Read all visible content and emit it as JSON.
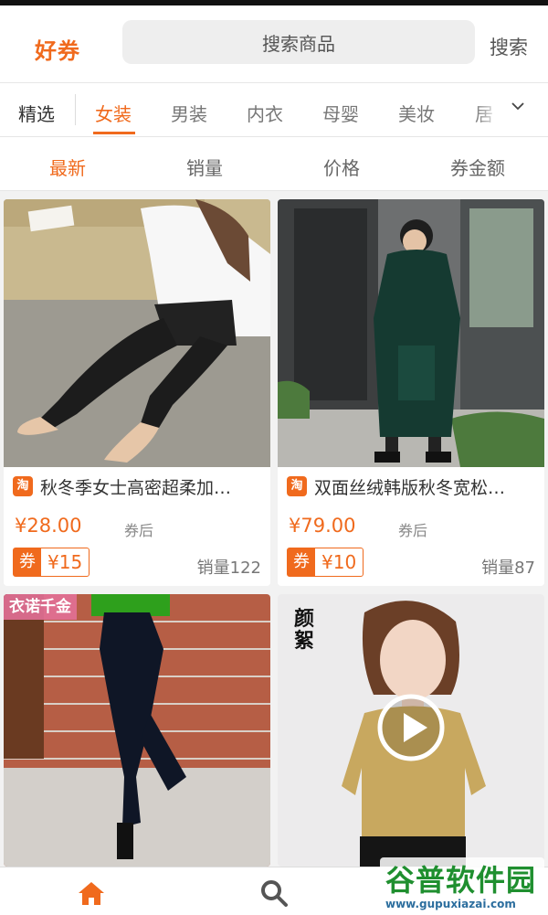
{
  "header": {
    "logo": "好券",
    "search_placeholder": "搜索商品",
    "search_button": "搜索"
  },
  "categories": {
    "featured": "精选",
    "items": [
      "女装",
      "男装",
      "内衣",
      "母婴",
      "美妆",
      "居"
    ],
    "active": "女装"
  },
  "sort": {
    "items": [
      "最新",
      "销量",
      "价格",
      "券金额"
    ],
    "active": "最新"
  },
  "products": [
    {
      "badge": "淘",
      "title": "秋冬季女士高密超柔加…",
      "price": "¥28.00",
      "price_suffix": "券后",
      "coupon_tag": "券",
      "coupon_value": "¥15",
      "sales": "销量122"
    },
    {
      "badge": "淘",
      "title": "双面丝绒韩版秋冬宽松…",
      "price": "¥79.00",
      "price_suffix": "券后",
      "coupon_tag": "券",
      "coupon_value": "¥10",
      "sales": "销量87"
    },
    {
      "image_text": "衣诺千金"
    },
    {
      "image_text": "颜絮"
    }
  ],
  "watermark": {
    "text": "谷普软件园",
    "url": "www.gupuxiazai.com"
  },
  "colors": {
    "accent": "#f06a1d",
    "watermark": "#1f8f2f"
  },
  "icons": {
    "home": "home-icon",
    "search": "search-icon",
    "dropdown": "chevron-down-icon",
    "play": "play-icon"
  }
}
